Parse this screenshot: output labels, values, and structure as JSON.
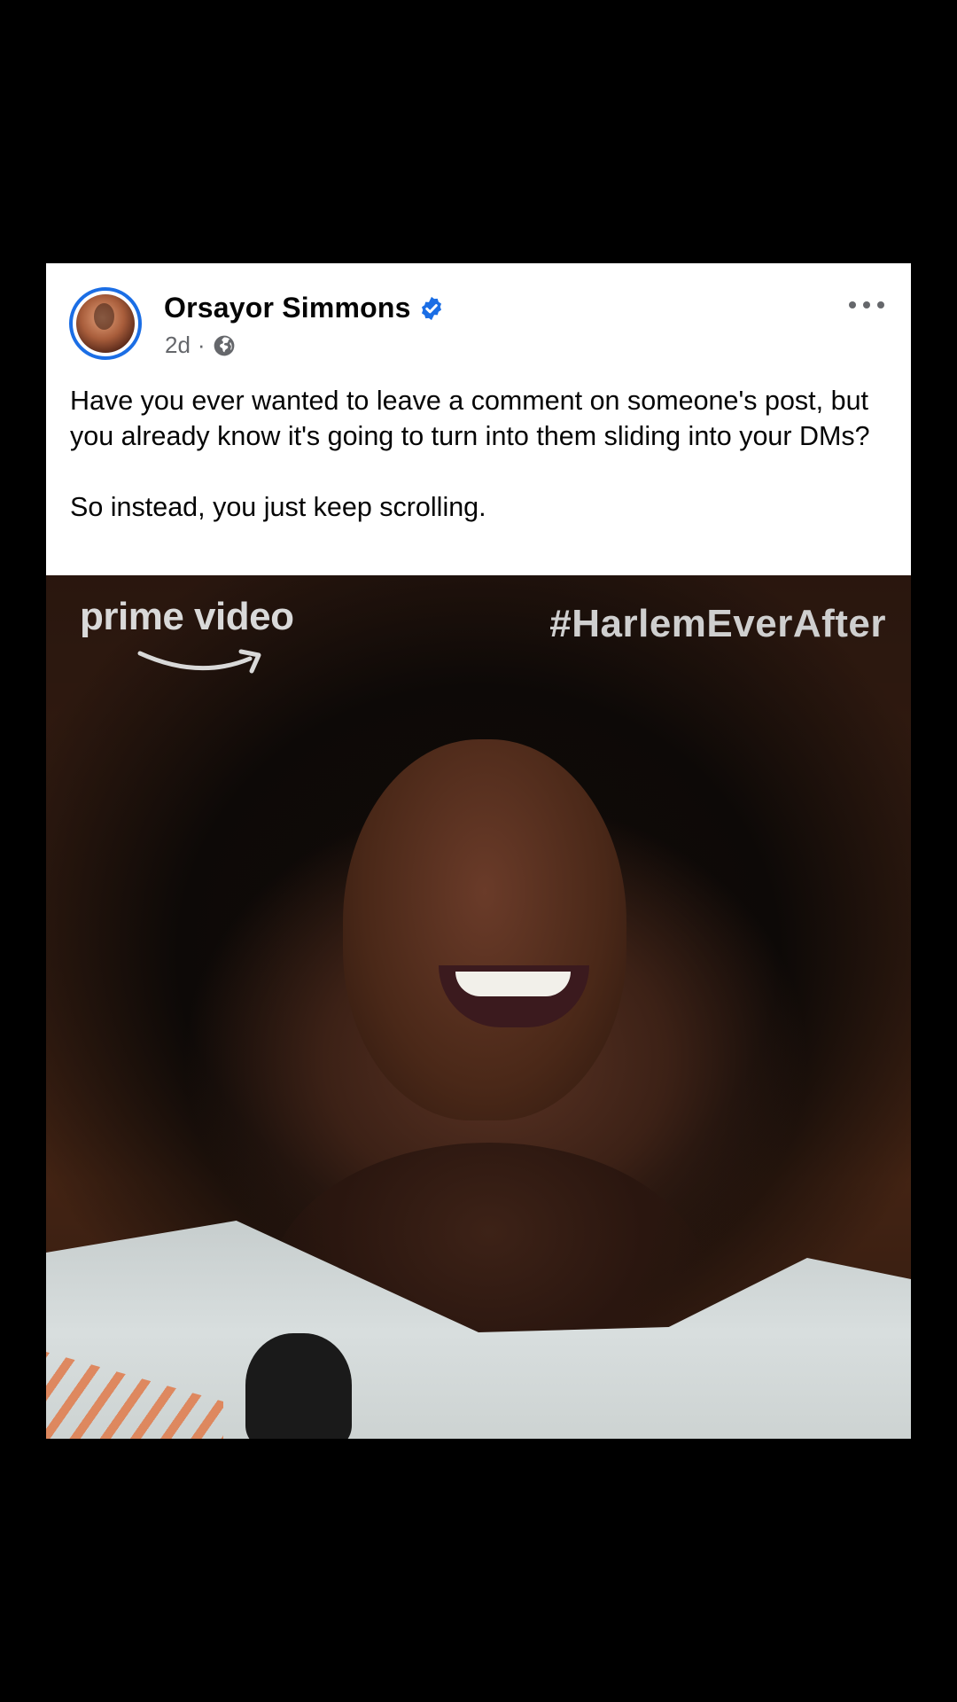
{
  "post": {
    "author_name": "Orsayor Simmons",
    "verified": true,
    "timestamp": "2d",
    "separator": "·",
    "audience_icon": "globe-icon",
    "more_icon": "more-options-icon",
    "text_paragraphs": [
      "Have you ever wanted to leave a comment on someone's post, but you already know it's going to turn into them sliding into your DMs?",
      "So instead, you just keep scrolling."
    ]
  },
  "media": {
    "brand_logo": "prime video",
    "hashtag": "#HarlemEverAfter"
  },
  "colors": {
    "background": "#000000",
    "card": "#ffffff",
    "verified": "#1b6ee5",
    "secondary_text": "#65676b"
  }
}
